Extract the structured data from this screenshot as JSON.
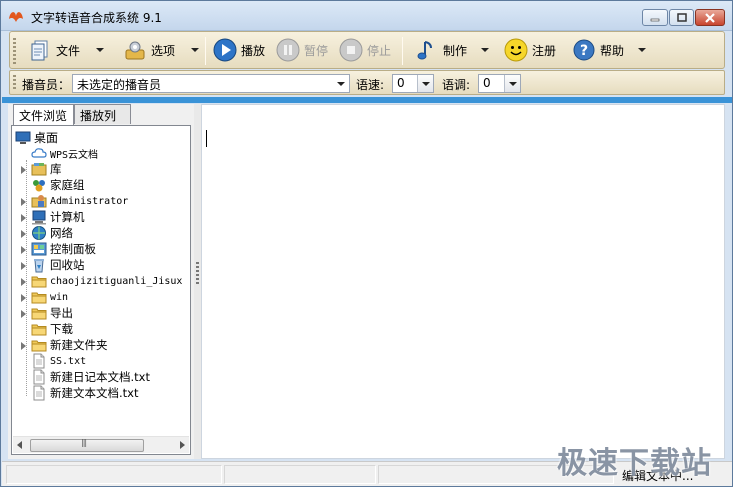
{
  "window": {
    "title": "文字转语音合成系统 9.1"
  },
  "toolbar": {
    "file_label": "文件",
    "options_label": "选项",
    "play_label": "播放",
    "pause_label": "暂停",
    "stop_label": "停止",
    "make_label": "制作",
    "register_label": "注册",
    "help_label": "帮助"
  },
  "voicebar": {
    "announcer_label": "播音员：",
    "announcer_value": "未选定的播音员",
    "speed_label": "语速:",
    "speed_value": "0",
    "pitch_label": "语调:",
    "pitch_value": "0"
  },
  "tabs": {
    "browse": "文件浏览",
    "playlist": "播放列表"
  },
  "tree": {
    "root": "桌面",
    "items": [
      {
        "label": "WPS云文档",
        "icon": "cloud-icon",
        "expandable": false,
        "mono": true
      },
      {
        "label": "库",
        "icon": "library-icon",
        "expandable": true,
        "mono": false
      },
      {
        "label": "家庭组",
        "icon": "homegroup-icon",
        "expandable": false,
        "mono": false
      },
      {
        "label": "Administrator",
        "icon": "user-folder-icon",
        "expandable": true,
        "mono": true
      },
      {
        "label": "计算机",
        "icon": "computer-icon",
        "expandable": true,
        "mono": false
      },
      {
        "label": "网络",
        "icon": "network-icon",
        "expandable": true,
        "mono": false
      },
      {
        "label": "控制面板",
        "icon": "control-panel-icon",
        "expandable": true,
        "mono": false
      },
      {
        "label": "回收站",
        "icon": "recycle-bin-icon",
        "expandable": true,
        "mono": false
      },
      {
        "label": "chaojizitiguanli_Jisux",
        "icon": "folder-icon",
        "expandable": true,
        "mono": true
      },
      {
        "label": "win",
        "icon": "folder-icon",
        "expandable": true,
        "mono": true
      },
      {
        "label": "导出",
        "icon": "folder-icon",
        "expandable": true,
        "mono": false
      },
      {
        "label": "下载",
        "icon": "folder-icon",
        "expandable": false,
        "mono": false
      },
      {
        "label": "新建文件夹",
        "icon": "folder-icon",
        "expandable": true,
        "mono": false
      },
      {
        "label": "SS.txt",
        "icon": "text-file-icon",
        "expandable": false,
        "mono": true
      },
      {
        "label": "新建日记本文档.txt",
        "icon": "text-file-icon",
        "expandable": false,
        "mono": false
      },
      {
        "label": "新建文本文档.txt",
        "icon": "text-file-icon",
        "expandable": false,
        "mono": false
      }
    ]
  },
  "status": {
    "text": "编辑文本中..."
  },
  "watermark": {
    "text": "极速下载站"
  },
  "colors": {
    "accent_stripe": "#3a93d7",
    "toolbar_bg": "#efe7cf",
    "folder": "#e8c05a"
  }
}
